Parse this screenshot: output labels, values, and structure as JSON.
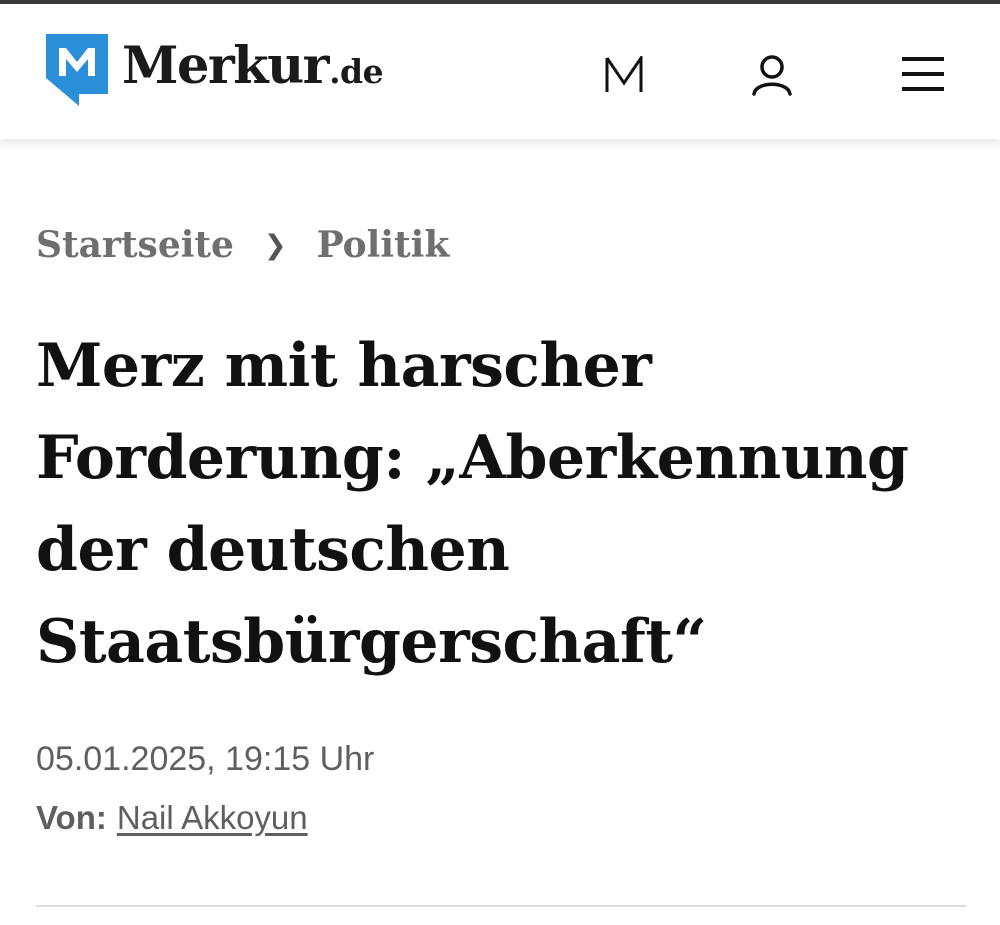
{
  "header": {
    "logo_text": "Merkur",
    "logo_tld": ".de",
    "icons": [
      "merkur-m-icon",
      "user-icon",
      "menu-icon"
    ]
  },
  "breadcrumb": {
    "items": [
      "Startseite",
      "Politik"
    ],
    "separator": "❯"
  },
  "article": {
    "headline_lines": [
      "Merz mit harscher",
      "Forderung: „Aberkennung",
      "der deutschen",
      "Staatsbürgerschaft“"
    ],
    "date": "05.01.2025, 19:15 Uhr",
    "byline_label": "Von:",
    "author": "Nail Akkoyun"
  },
  "colors": {
    "brand_blue": "#2a8fd6",
    "text_dark": "#111111",
    "text_gray": "#6f6f6f"
  }
}
